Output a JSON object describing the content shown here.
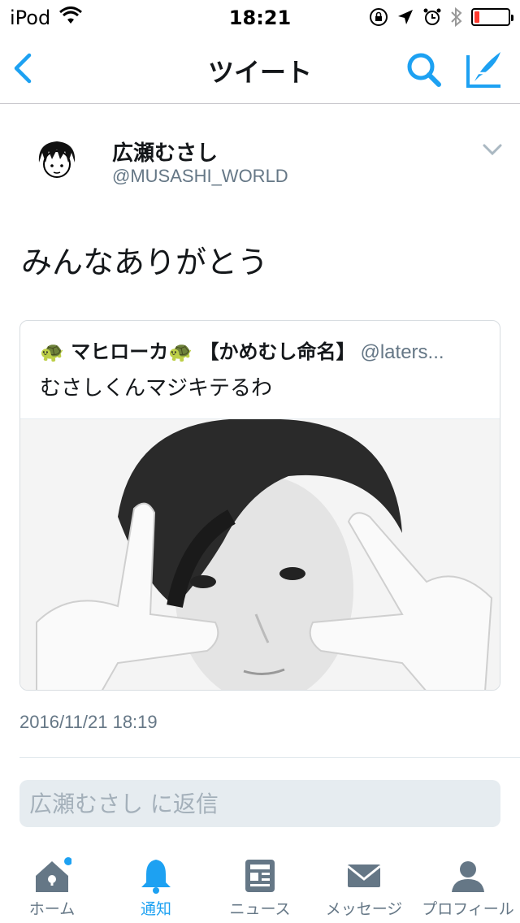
{
  "status_bar": {
    "carrier": "iPod",
    "time": "18:21",
    "battery_level": 0.15
  },
  "nav": {
    "title": "ツイート",
    "back_icon": "chevron-left-icon",
    "search_icon": "search-icon",
    "compose_icon": "compose-tweet-icon"
  },
  "tweet": {
    "display_name": "広瀬むさし",
    "handle": "@MUSASHI_WORLD",
    "text": "みんなありがとう",
    "timestamp": "2016/11/21 18:19"
  },
  "quote": {
    "name": "🐢 マヒローカ🐢 【かめむし命名】",
    "handle": "@laters...",
    "text": "むさしくんマジキテるわ"
  },
  "reply": {
    "placeholder": "広瀬むさし に返信"
  },
  "tabs": [
    {
      "label": "ホーム",
      "icon": "home-icon"
    },
    {
      "label": "通知",
      "icon": "bell-icon"
    },
    {
      "label": "ニュース",
      "icon": "news-icon"
    },
    {
      "label": "メッセージ",
      "icon": "envelope-icon"
    },
    {
      "label": "プロフィール",
      "icon": "person-icon"
    }
  ],
  "colors": {
    "accent": "#1da1f2",
    "text": "#14171a",
    "muted": "#657786",
    "tab_inactive": "#657786",
    "battery_low": "#ff3b30"
  }
}
